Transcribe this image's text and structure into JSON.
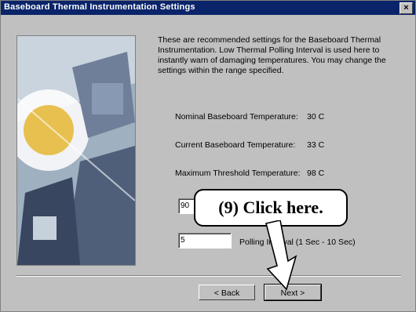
{
  "window": {
    "title": "Baseboard Thermal Instrumentation Settings",
    "close_glyph": "×"
  },
  "description": "These are recommended settings for the Baseboard Thermal Instrumentation. Low Thermal Polling Interval is used here to instantly warn of damaging temperatures. You may change the settings within the range specified.",
  "readings": [
    {
      "label": "Nominal Baseboard Temperature:",
      "value": "30 C"
    },
    {
      "label": "Current Baseboard Temperature:",
      "value": "33 C"
    },
    {
      "label": "Maximum Threshold Temperature:",
      "value": "98 C"
    }
  ],
  "threshold_field": {
    "value": "90"
  },
  "polling": {
    "value": "5",
    "label": "Polling Interval (1 Sec - 10 Sec)"
  },
  "buttons": {
    "back": "< Back",
    "next": "Next >"
  },
  "callout": {
    "text": "(9)  Click here."
  }
}
